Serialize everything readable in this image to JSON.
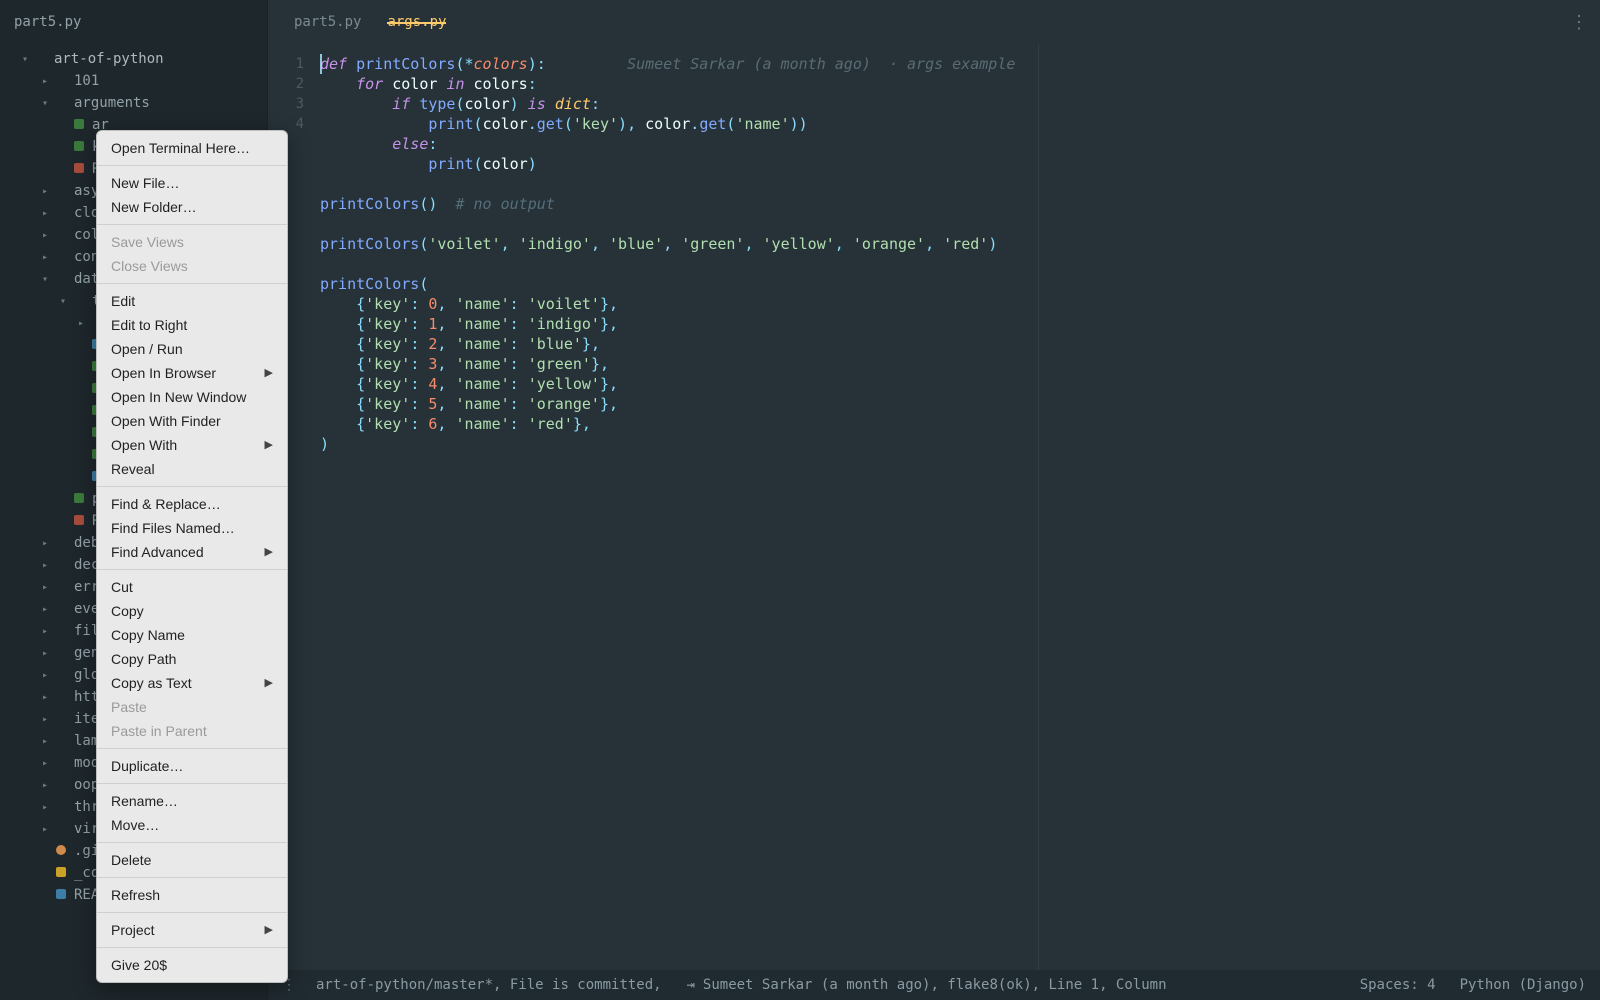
{
  "open_files": {
    "file": "part5.py"
  },
  "project_root": "art-of-python",
  "tree": [
    {
      "d": 0,
      "arrow": "▾",
      "icon": "blank",
      "label": "art-of-python"
    },
    {
      "d": 1,
      "arrow": "▸",
      "icon": "blank",
      "label": "101"
    },
    {
      "d": 1,
      "arrow": "▾",
      "icon": "blank",
      "label": "arguments"
    },
    {
      "d": 2,
      "arrow": "",
      "icon": "py",
      "label": "ar"
    },
    {
      "d": 2,
      "arrow": "",
      "icon": "py",
      "label": "kw"
    },
    {
      "d": 2,
      "arrow": "",
      "icon": "rst",
      "label": "RE"
    },
    {
      "d": 1,
      "arrow": "▸",
      "icon": "blank",
      "label": "asyn"
    },
    {
      "d": 1,
      "arrow": "▸",
      "icon": "blank",
      "label": "clos"
    },
    {
      "d": 1,
      "arrow": "▸",
      "icon": "blank",
      "label": "coll"
    },
    {
      "d": 1,
      "arrow": "▸",
      "icon": "blank",
      "label": "cont"
    },
    {
      "d": 1,
      "arrow": "▾",
      "icon": "blank",
      "label": "data"
    },
    {
      "d": 2,
      "arrow": "▾",
      "icon": "blank",
      "label": "t"
    },
    {
      "d": 3,
      "arrow": "▸",
      "icon": "blank",
      "label": ""
    },
    {
      "d": 3,
      "arrow": "",
      "icon": "md",
      "label": ""
    },
    {
      "d": 3,
      "arrow": "",
      "icon": "py",
      "label": ""
    },
    {
      "d": 3,
      "arrow": "",
      "icon": "py",
      "label": ""
    },
    {
      "d": 3,
      "arrow": "",
      "icon": "py",
      "label": ""
    },
    {
      "d": 3,
      "arrow": "",
      "icon": "py",
      "label": ""
    },
    {
      "d": 3,
      "arrow": "",
      "icon": "py",
      "label": ""
    },
    {
      "d": 3,
      "arrow": "",
      "icon": "md",
      "label": ""
    },
    {
      "d": 2,
      "arrow": "",
      "icon": "py",
      "label": "pa"
    },
    {
      "d": 2,
      "arrow": "",
      "icon": "rst",
      "label": "RE"
    },
    {
      "d": 1,
      "arrow": "▸",
      "icon": "blank",
      "label": "debu"
    },
    {
      "d": 1,
      "arrow": "▸",
      "icon": "blank",
      "label": "deco"
    },
    {
      "d": 1,
      "arrow": "▸",
      "icon": "blank",
      "label": "erro"
    },
    {
      "d": 1,
      "arrow": "▸",
      "icon": "blank",
      "label": "even"
    },
    {
      "d": 1,
      "arrow": "▸",
      "icon": "blank",
      "label": "file-"
    },
    {
      "d": 1,
      "arrow": "▸",
      "icon": "blank",
      "label": "gene"
    },
    {
      "d": 1,
      "arrow": "▸",
      "icon": "blank",
      "label": "glob"
    },
    {
      "d": 1,
      "arrow": "▸",
      "icon": "blank",
      "label": "http"
    },
    {
      "d": 1,
      "arrow": "▸",
      "icon": "blank",
      "label": "iter"
    },
    {
      "d": 1,
      "arrow": "▸",
      "icon": "blank",
      "label": "lamb"
    },
    {
      "d": 1,
      "arrow": "▸",
      "icon": "blank",
      "label": "modu"
    },
    {
      "d": 1,
      "arrow": "▸",
      "icon": "blank",
      "label": "oop"
    },
    {
      "d": 1,
      "arrow": "▸",
      "icon": "blank",
      "label": "thre"
    },
    {
      "d": 1,
      "arrow": "▸",
      "icon": "blank",
      "label": "virt"
    },
    {
      "d": 1,
      "arrow": "",
      "icon": "git",
      "label": ".git"
    },
    {
      "d": 1,
      "arrow": "",
      "icon": "yml",
      "label": "_con"
    },
    {
      "d": 1,
      "arrow": "",
      "icon": "md",
      "label": "README.md"
    }
  ],
  "tabs": [
    {
      "label": "part5.py",
      "active": false
    },
    {
      "label": "args.py",
      "active": true
    }
  ],
  "blame_inline": "Sumeet Sarkar (a month ago)  · args example",
  "code": {
    "raw_lines_count": 21,
    "def_kw": "def",
    "fn_name": "printColors",
    "star": "*",
    "arg": "colors",
    "for_kw": "for",
    "color": "color",
    "in_kw": "in",
    "if_kw": "if",
    "type_fn": "type",
    "is_kw": "is",
    "dict_kw": "dict",
    "print_fn": "print",
    "get": "get",
    "key_str": "'key'",
    "name_str": "'name'",
    "else_kw": "else",
    "no_output": "# no output",
    "call1": [
      "'voilet'",
      "'indigo'",
      "'blue'",
      "'green'",
      "'yellow'",
      "'orange'",
      "'red'"
    ],
    "dicts": [
      {
        "k": 0,
        "n": "'voilet'"
      },
      {
        "k": 1,
        "n": "'indigo'"
      },
      {
        "k": 2,
        "n": "'blue'"
      },
      {
        "k": 3,
        "n": "'green'"
      },
      {
        "k": 4,
        "n": "'yellow'"
      },
      {
        "k": 5,
        "n": "'orange'"
      },
      {
        "k": 6,
        "n": "'red'"
      }
    ]
  },
  "gutter_lines": [
    "1",
    "2",
    "3",
    "4",
    "",
    "",
    "",
    "",
    "",
    "",
    "",
    "",
    "",
    "",
    "",
    "",
    "",
    "",
    "",
    "",
    ""
  ],
  "status": {
    "branch": "art-of-python/master*",
    "commit_state": "File is committed",
    "blame": "Sumeet Sarkar (a month ago)",
    "lint": "flake8(ok)",
    "pos": "Line 1, Column",
    "spaces": "Spaces: 4",
    "lang": "Python (Django)"
  },
  "context_menu": [
    {
      "type": "item",
      "label": "Open Terminal Here…"
    },
    {
      "type": "sep"
    },
    {
      "type": "item",
      "label": "New File…"
    },
    {
      "type": "item",
      "label": "New Folder…"
    },
    {
      "type": "sep"
    },
    {
      "type": "item",
      "label": "Save Views",
      "disabled": true
    },
    {
      "type": "item",
      "label": "Close Views",
      "disabled": true
    },
    {
      "type": "sep"
    },
    {
      "type": "item",
      "label": "Edit"
    },
    {
      "type": "item",
      "label": "Edit to Right"
    },
    {
      "type": "item",
      "label": "Open / Run"
    },
    {
      "type": "item",
      "label": "Open In Browser",
      "submenu": true
    },
    {
      "type": "item",
      "label": "Open In New Window"
    },
    {
      "type": "item",
      "label": "Open With Finder"
    },
    {
      "type": "item",
      "label": "Open With",
      "submenu": true
    },
    {
      "type": "item",
      "label": "Reveal"
    },
    {
      "type": "sep"
    },
    {
      "type": "item",
      "label": "Find & Replace…"
    },
    {
      "type": "item",
      "label": "Find Files Named…"
    },
    {
      "type": "item",
      "label": "Find Advanced",
      "submenu": true
    },
    {
      "type": "sep"
    },
    {
      "type": "item",
      "label": "Cut"
    },
    {
      "type": "item",
      "label": "Copy"
    },
    {
      "type": "item",
      "label": "Copy Name"
    },
    {
      "type": "item",
      "label": "Copy Path"
    },
    {
      "type": "item",
      "label": "Copy as Text",
      "submenu": true
    },
    {
      "type": "item",
      "label": "Paste",
      "disabled": true
    },
    {
      "type": "item",
      "label": "Paste in Parent",
      "disabled": true
    },
    {
      "type": "sep"
    },
    {
      "type": "item",
      "label": "Duplicate…"
    },
    {
      "type": "sep"
    },
    {
      "type": "item",
      "label": "Rename…"
    },
    {
      "type": "item",
      "label": "Move…"
    },
    {
      "type": "sep"
    },
    {
      "type": "item",
      "label": "Delete"
    },
    {
      "type": "sep"
    },
    {
      "type": "item",
      "label": "Refresh"
    },
    {
      "type": "sep"
    },
    {
      "type": "item",
      "label": "Project",
      "submenu": true
    },
    {
      "type": "sep"
    },
    {
      "type": "item",
      "label": "Give 20$"
    }
  ]
}
